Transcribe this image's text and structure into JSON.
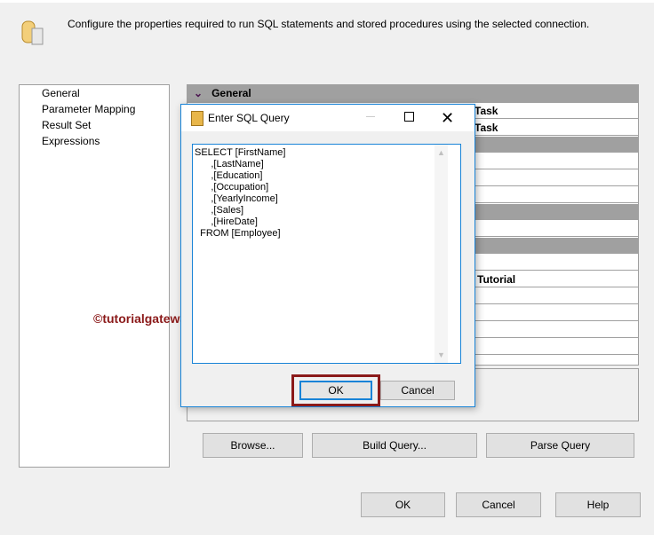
{
  "header": {
    "description": "Configure the properties required to run SQL statements and stored procedures using the selected connection.",
    "icon": "sql-task-icon"
  },
  "nav": {
    "items": [
      "General",
      "Parameter Mapping",
      "Result Set",
      "Expressions"
    ]
  },
  "grid": {
    "category": "General",
    "visible_values": [
      "Task",
      "Task",
      "Tutorial"
    ]
  },
  "watermark": "©tutorialgateway.org",
  "buttons": {
    "browse": "Browse...",
    "build_query": "Build Query...",
    "parse_query": "Parse Query",
    "ok": "OK",
    "cancel": "Cancel",
    "help": "Help"
  },
  "dialog": {
    "title": "Enter SQL Query",
    "sql": "SELECT [FirstName]\n      ,[LastName]\n      ,[Education]\n      ,[Occupation]\n      ,[YearlyIncome]\n      ,[Sales]\n      ,[HireDate]\n  FROM [Employee]",
    "ok": "OK",
    "cancel": "Cancel"
  },
  "colors": {
    "highlight": "#8b1a1a",
    "accent": "#1883d7"
  }
}
